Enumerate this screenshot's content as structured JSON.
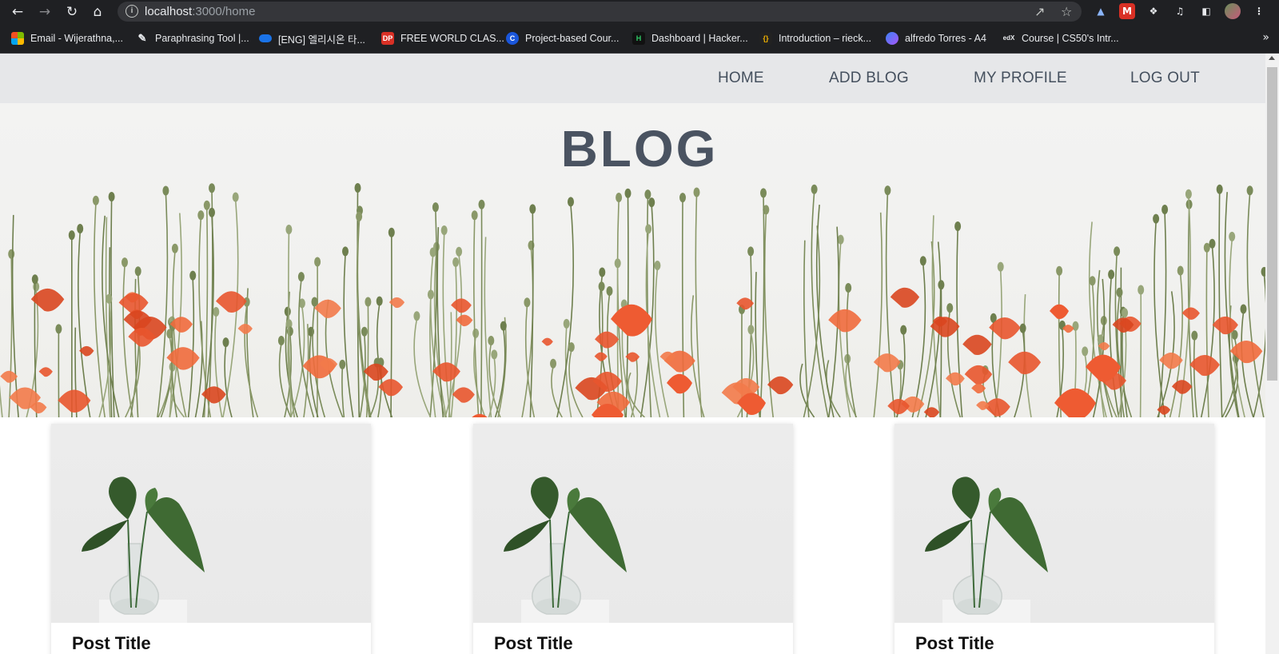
{
  "browser": {
    "url_host": "localhost",
    "url_path": ":3000/home",
    "bookmarks": [
      {
        "label": "Email - Wijerathna,...",
        "icon": "microsoft-icon",
        "color": "#f25022"
      },
      {
        "label": "Paraphrasing Tool |...",
        "icon": "quill-icon",
        "color": "#9aa0a6"
      },
      {
        "label": "[ENG] 엘리시온 타...",
        "icon": "onedrive-icon",
        "color": "#1a73e8"
      },
      {
        "label": "FREE WORLD CLAS...",
        "icon": "dp-icon",
        "color": "#d93025"
      },
      {
        "label": "Project-based Cour...",
        "icon": "coursera-icon",
        "color": "#1a56db"
      },
      {
        "label": "Dashboard | Hacker...",
        "icon": "hackerrank-icon",
        "color": "#111111"
      },
      {
        "label": "Introduction – rieck...",
        "icon": "code-icon",
        "color": "#222222"
      },
      {
        "label": "alfredo Torres - A4",
        "icon": "gradient-icon",
        "color": "#8a5cf6"
      },
      {
        "label": "Course | CS50's Intr...",
        "icon": "edx-icon",
        "color": "#1f2023"
      }
    ]
  },
  "nav": {
    "home": "HOME",
    "add_blog": "ADD BLOG",
    "my_profile": "MY PROFILE",
    "log_out": "LOG OUT"
  },
  "hero": {
    "title": "BLOG"
  },
  "posts": [
    {
      "title": "Post Title"
    },
    {
      "title": "Post Title"
    },
    {
      "title": "Post Title"
    }
  ]
}
